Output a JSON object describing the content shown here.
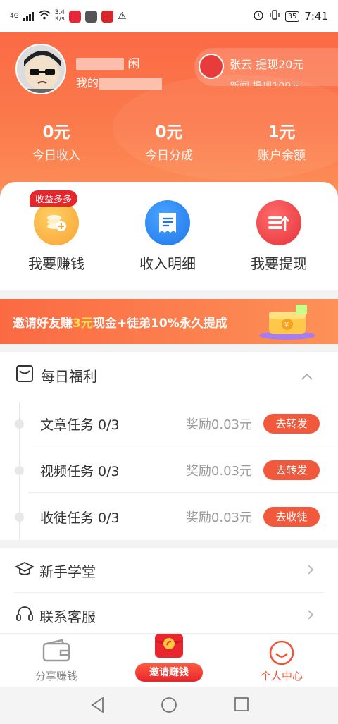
{
  "status_bar": {
    "signal": "4G",
    "net_speed_value": "3.4",
    "net_speed_unit": "K/s",
    "battery": "35",
    "time": "7:41"
  },
  "profile": {
    "name_visible": "闲",
    "id_prefix": "我的"
  },
  "ticker": {
    "line1": "张云 提现20元",
    "line2": "新闻 提现100元"
  },
  "stats": [
    {
      "value": "0元",
      "label": "今日收入"
    },
    {
      "value": "0元",
      "label": "今日分成"
    },
    {
      "value": "1元",
      "label": "账户余额"
    }
  ],
  "actions": [
    {
      "label": "我要赚钱",
      "badge": "收益多多",
      "icon": "coins-icon",
      "color": "#fbb23e"
    },
    {
      "label": "收入明细",
      "icon": "receipt-icon",
      "color": "#2f8cf5"
    },
    {
      "label": "我要提现",
      "icon": "withdraw-icon",
      "color": "#f24b4f"
    }
  ],
  "banner": {
    "part1": "邀请好友赚",
    "highlight": "3元",
    "part2": "现金+徒弟10%永久提成"
  },
  "daily": {
    "title": "每日福利",
    "tasks": [
      {
        "name": "文章任务 0/3",
        "reward": "奖励0.03元",
        "button": "去转发"
      },
      {
        "name": "视频任务 0/3",
        "reward": "奖励0.03元",
        "button": "去转发"
      },
      {
        "name": "收徒任务 0/3",
        "reward": "奖励0.03元",
        "button": "去收徒"
      }
    ]
  },
  "menu": [
    {
      "label": "新手学堂",
      "icon": "graduation-cap-icon"
    },
    {
      "label": "联系客服",
      "icon": "headset-icon"
    }
  ],
  "nav": {
    "share": "分享赚钱",
    "invite": "邀请赚钱",
    "profile": "个人中心"
  },
  "colors": {
    "primary": "#f0553a",
    "header_top": "#fb6a45",
    "accent_yellow": "#ffe24a"
  }
}
